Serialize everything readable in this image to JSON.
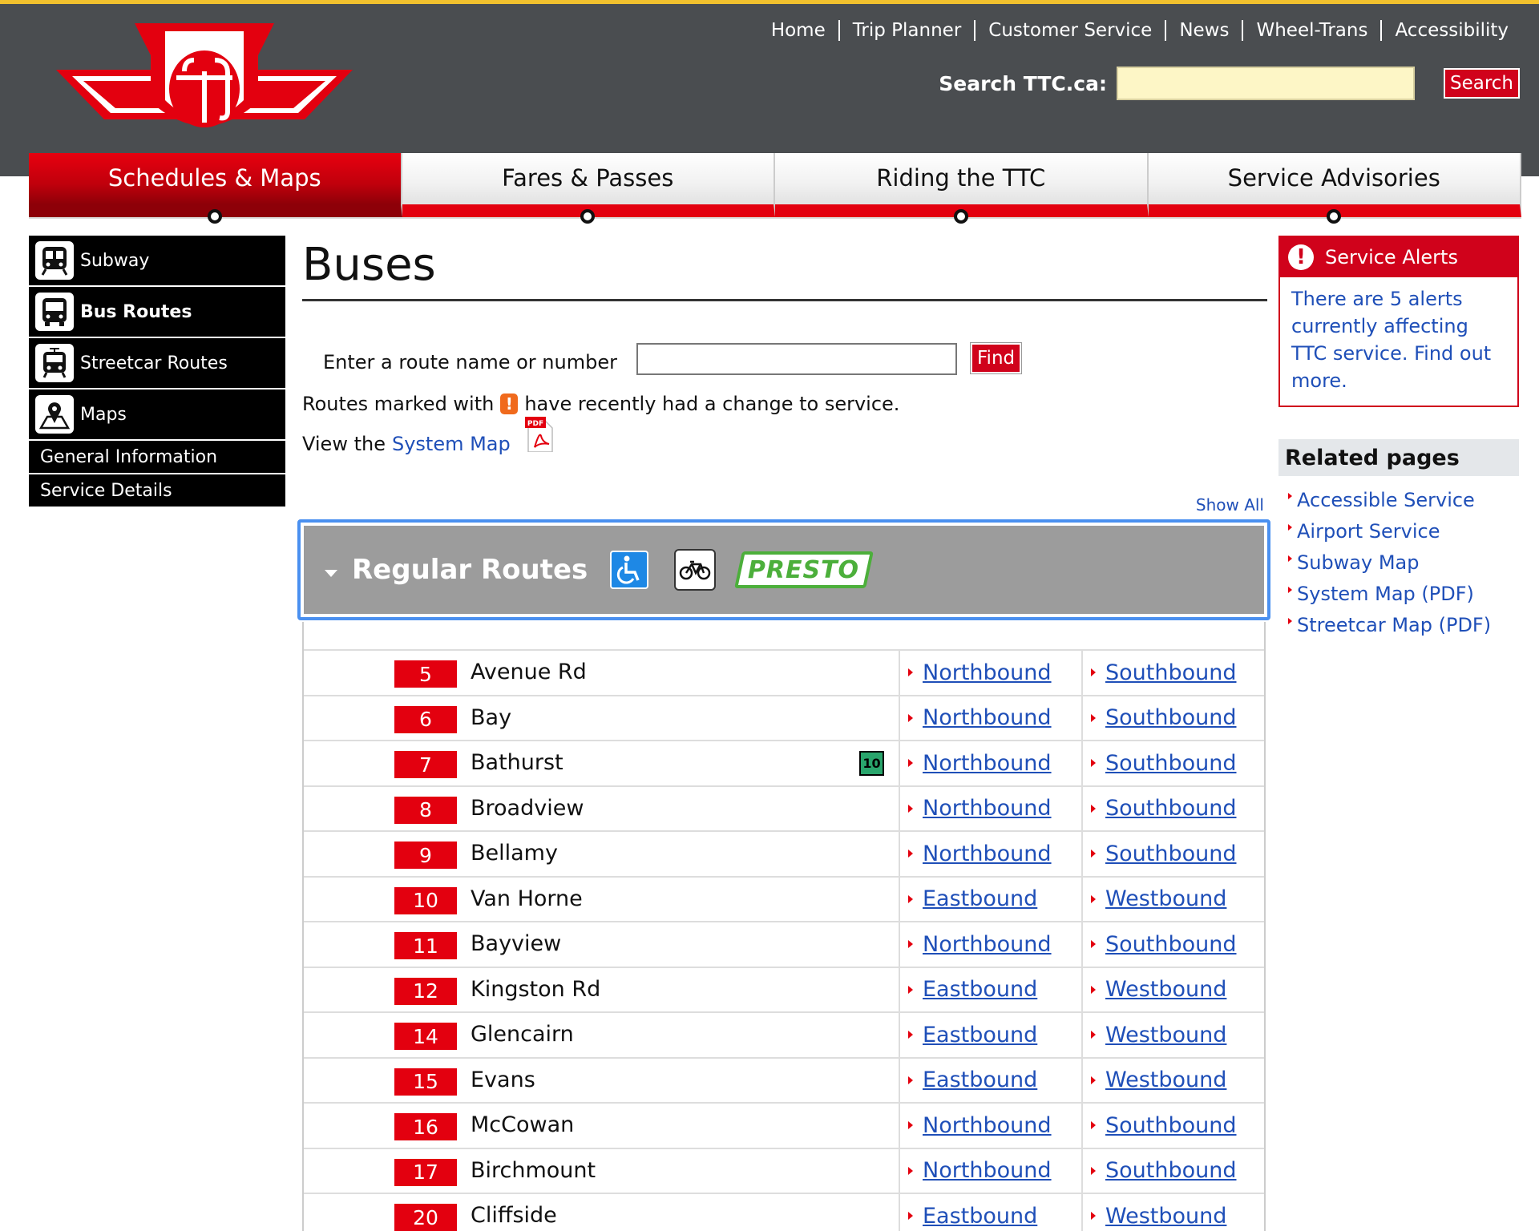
{
  "header": {
    "nav": [
      "Home",
      "Trip Planner",
      "Customer Service",
      "News",
      "Wheel-Trans",
      "Accessibility"
    ],
    "search_label": "Search TTC.ca:",
    "search_value": "",
    "search_button": "Search"
  },
  "main_tabs": [
    {
      "label": "Schedules & Maps",
      "active": true
    },
    {
      "label": "Fares & Passes",
      "active": false
    },
    {
      "label": "Riding the TTC",
      "active": false
    },
    {
      "label": "Service Advisories",
      "active": false
    }
  ],
  "sidebar": {
    "items": [
      {
        "label": "Subway",
        "icon": "subway-icon"
      },
      {
        "label": "Bus Routes",
        "icon": "bus-icon"
      },
      {
        "label": "Streetcar Routes",
        "icon": "streetcar-icon"
      },
      {
        "label": "Maps",
        "icon": "map-pin-icon"
      }
    ],
    "sub_items": [
      "General Information",
      "Service Details"
    ]
  },
  "main": {
    "title": "Buses",
    "find_label": "Enter a route name or number",
    "find_value": "",
    "find_button": "Find",
    "marked_prefix": "Routes marked with",
    "marked_icon": "!",
    "marked_suffix": "have recently had a change to service.",
    "view_prefix": "View the",
    "system_map_link": "System Map",
    "pdf_label": "PDF",
    "show_all": "Show All",
    "regular_routes_title": "Regular Routes",
    "presto_label": "PRESTO"
  },
  "routes": [
    {
      "num": "5",
      "name": "Avenue Rd",
      "dir1": "Northbound",
      "dir2": "Southbound"
    },
    {
      "num": "6",
      "name": "Bay",
      "dir1": "Northbound",
      "dir2": "Southbound"
    },
    {
      "num": "7",
      "name": "Bathurst",
      "badge": "10",
      "dir1": "Northbound",
      "dir2": "Southbound"
    },
    {
      "num": "8",
      "name": "Broadview",
      "dir1": "Northbound",
      "dir2": "Southbound"
    },
    {
      "num": "9",
      "name": "Bellamy",
      "dir1": "Northbound",
      "dir2": "Southbound"
    },
    {
      "num": "10",
      "name": "Van Horne",
      "dir1": "Eastbound",
      "dir2": "Westbound"
    },
    {
      "num": "11",
      "name": "Bayview",
      "dir1": "Northbound",
      "dir2": "Southbound"
    },
    {
      "num": "12",
      "name": "Kingston Rd",
      "dir1": "Eastbound",
      "dir2": "Westbound"
    },
    {
      "num": "14",
      "name": "Glencairn",
      "dir1": "Eastbound",
      "dir2": "Westbound"
    },
    {
      "num": "15",
      "name": "Evans",
      "dir1": "Eastbound",
      "dir2": "Westbound"
    },
    {
      "num": "16",
      "name": "McCowan",
      "dir1": "Northbound",
      "dir2": "Southbound"
    },
    {
      "num": "17",
      "name": "Birchmount",
      "dir1": "Northbound",
      "dir2": "Southbound"
    },
    {
      "num": "20",
      "name": "Cliffside",
      "dir1": "Eastbound",
      "dir2": "Westbound"
    }
  ],
  "alerts": {
    "title": "Service Alerts",
    "icon": "!",
    "body": "There are 5 alerts currently affecting TTC service. Find out more."
  },
  "related": {
    "title": "Related pages",
    "items": [
      "Accessible Service",
      "Airport Service",
      "Subway Map",
      "System Map (PDF)",
      "Streetcar Map (PDF)"
    ]
  },
  "colors": {
    "header_bg": "#4a4d50",
    "brand_red": "#e3000f",
    "link_blue": "#1f4fb8",
    "presto_green": "#4caf3b"
  }
}
